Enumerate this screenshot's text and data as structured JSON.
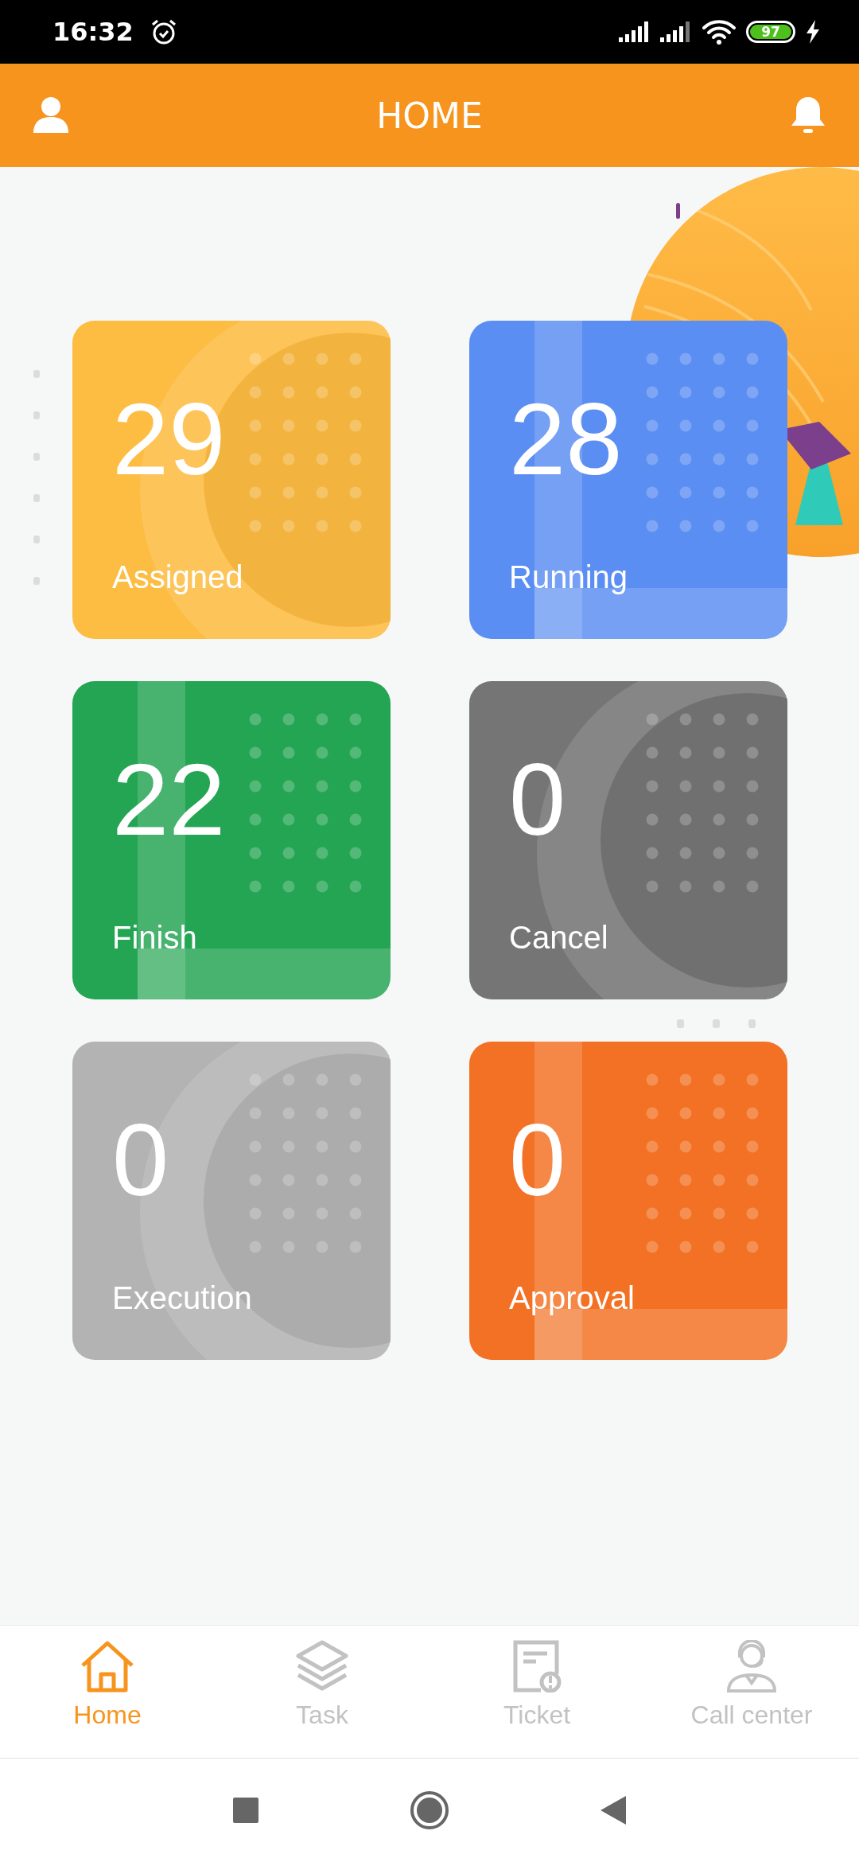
{
  "status_bar": {
    "time": "16:32",
    "battery": "97"
  },
  "header": {
    "title": "HOME"
  },
  "cards": [
    {
      "count": "29",
      "label": "Assigned",
      "color": "#fdbc42",
      "kind": "ring"
    },
    {
      "count": "28",
      "label": "Running",
      "color": "#5b8ef2",
      "kind": "panel"
    },
    {
      "count": "22",
      "label": "Finish",
      "color": "#24a553",
      "kind": "panel"
    },
    {
      "count": "0",
      "label": "Cancel",
      "color": "#757575",
      "kind": "ring"
    },
    {
      "count": "0",
      "label": "Execution",
      "color": "#b3b3b3",
      "kind": "ring"
    },
    {
      "count": "0",
      "label": "Approval",
      "color": "#f37124",
      "kind": "panel"
    }
  ],
  "nav": [
    {
      "label": "Home",
      "kind": "home",
      "selected": true
    },
    {
      "label": "Task",
      "kind": "layers",
      "selected": false
    },
    {
      "label": "Ticket",
      "kind": "ticket",
      "selected": false
    },
    {
      "label": "Call center",
      "kind": "agent",
      "selected": false
    }
  ]
}
